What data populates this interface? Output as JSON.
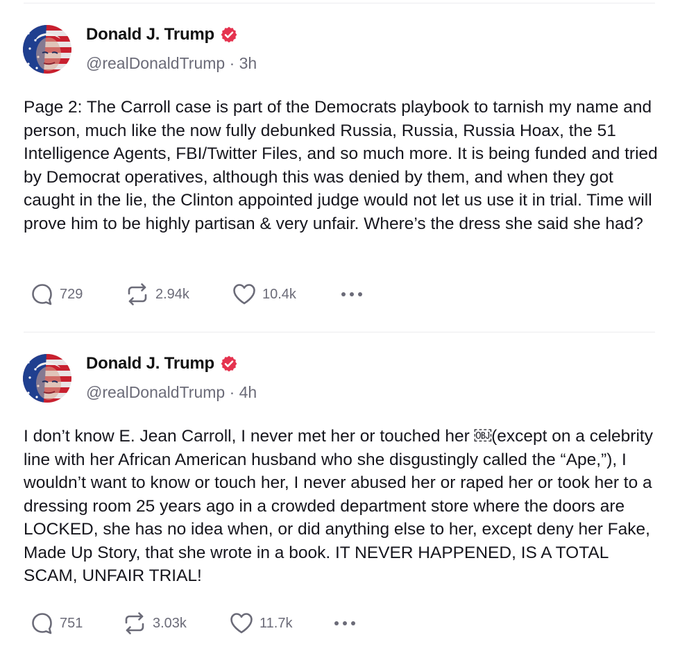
{
  "colors": {
    "verified_badge": "#e5334f",
    "meta_text": "#6b6b78",
    "divider": "#ececef"
  },
  "posts": [
    {
      "author": "Donald J. Trump",
      "verified_icon": "verified-badge-icon",
      "handle": "@realDonaldTrump",
      "separator": "·",
      "time": "3h",
      "text": "Page 2: The Carroll case is part of the Democrats playbook to tarnish my name and person, much like the now fully debunked Russia, Russia, Russia Hoax, the 51 Intelligence Agents, FBI/Twitter Files, and so much more. It is being funded and tried by Democrat operatives, although this was denied by them, and when they got caught in the lie, the Clinton appointed judge would not let us use it in trial. Time will prove him to be highly partisan & very unfair. Where’s the dress she said she had?",
      "replies": "729",
      "reposts": "2.94k",
      "likes": "10.4k"
    },
    {
      "author": "Donald J. Trump",
      "verified_icon": "verified-badge-icon",
      "handle": "@realDonaldTrump",
      "separator": "·",
      "time": "4h",
      "text": "I don’t know E. Jean Carroll, I never met her or touched her ￼(except on a celebrity line with her African American husband who she disgustingly called the “Ape,”), I wouldn’t want to know or touch her, I never abused her or raped her or took her to a dressing room 25 years ago in a crowded department store where the doors are LOCKED, she has no idea when, or did anything else to her, except deny her Fake, Made Up Story, that she wrote in a book. IT NEVER HAPPENED, IS A TOTAL SCAM, UNFAIR TRIAL!",
      "replies": "751",
      "reposts": "3.03k",
      "likes": "11.7k"
    }
  ]
}
